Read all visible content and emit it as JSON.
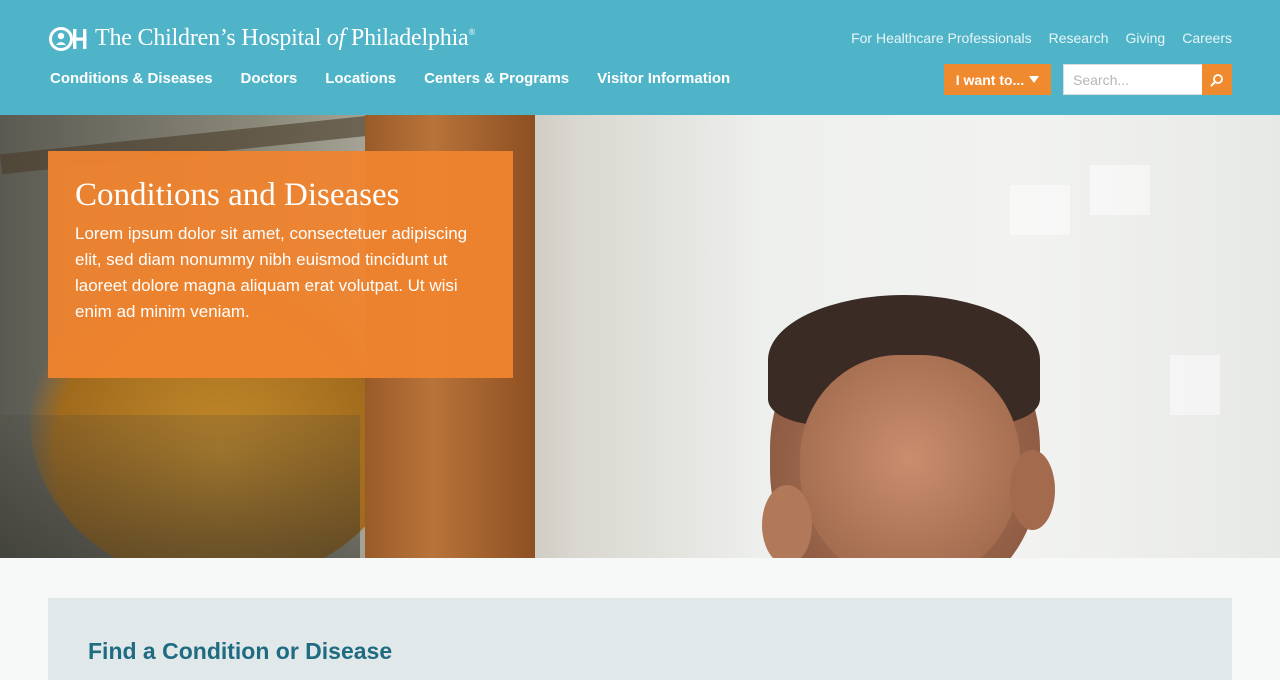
{
  "header": {
    "logo": {
      "name": "The Children’s Hospital ",
      "of": "of",
      "place": " Philadelphia",
      "mark": "®"
    },
    "utility_links": [
      "For Healthcare Professionals",
      "Research",
      "Giving",
      "Careers"
    ],
    "nav": [
      "Conditions & Diseases",
      "Doctors",
      "Locations",
      "Centers & Programs",
      "Visitor Information"
    ],
    "iwant_label": "I want to...",
    "search": {
      "placeholder": "Search..."
    },
    "colors": {
      "bar": "#50b4c9",
      "accent": "#f08a2f"
    }
  },
  "hero": {
    "title": "Conditions and Diseases",
    "body": "Lorem ipsum dolor sit amet, consectetuer adipiscing elit, sed diam nonummy nibh euismod tincidunt ut laoreet dolore magna aliquam erat volutpat. Ut wisi enim ad minim veniam."
  },
  "finder": {
    "title": "Find a Condition or Disease"
  }
}
